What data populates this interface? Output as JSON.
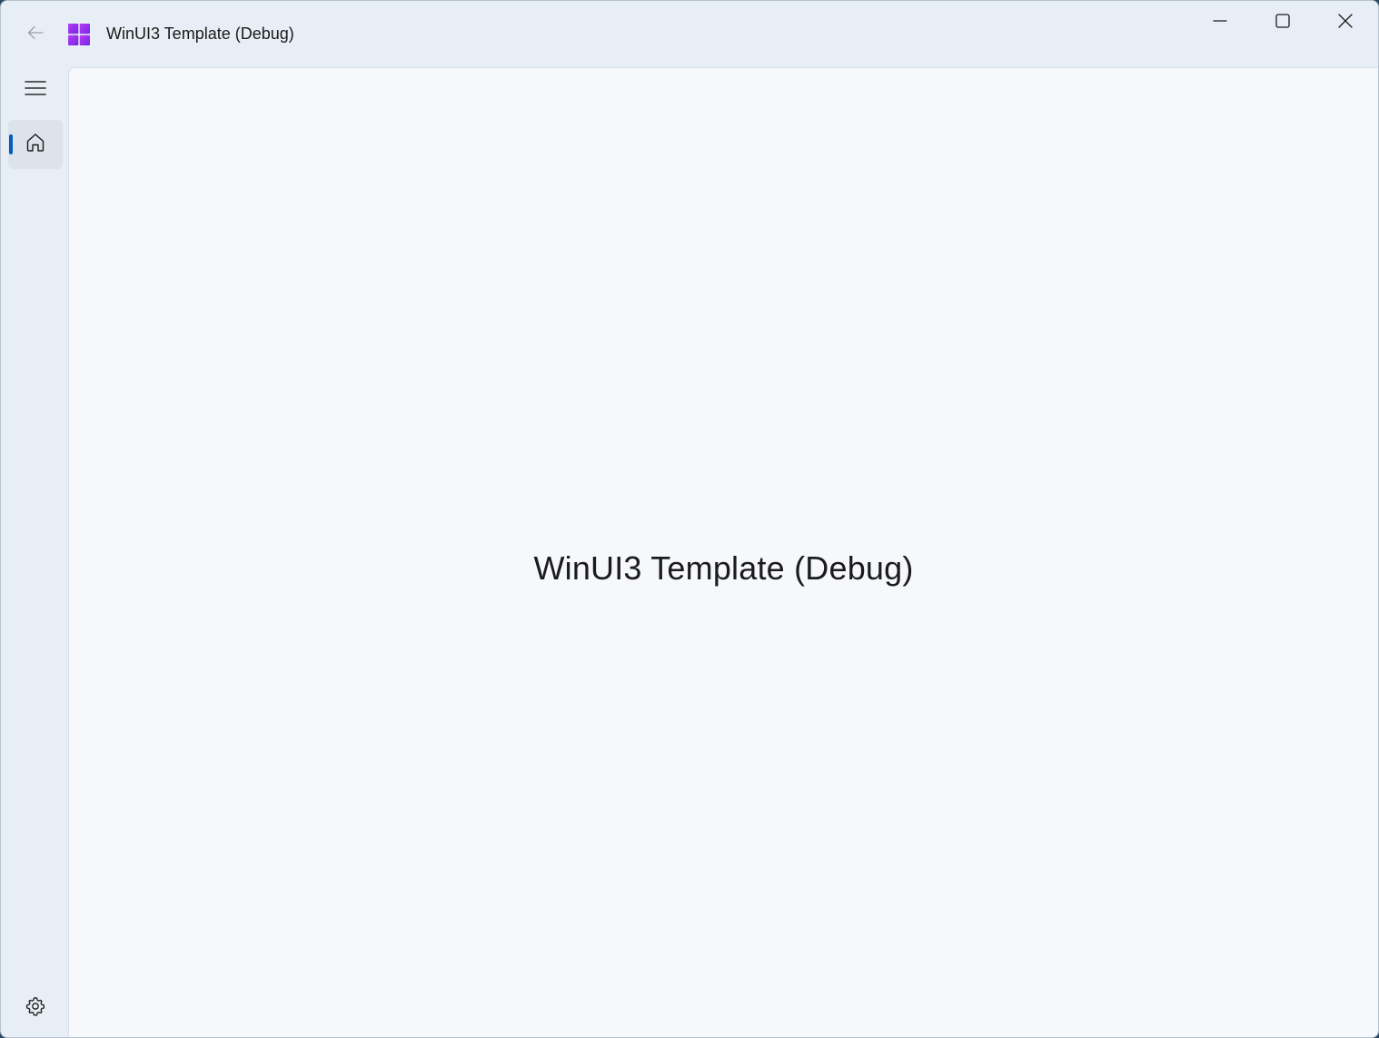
{
  "window": {
    "title": "WinUI3 Template (Debug)"
  },
  "titlebar": {
    "back_icon": "arrow-left-icon",
    "app_icon": "windows-logo-icon",
    "app_icon_colors": [
      "#7b2ff7",
      "#b23cf0",
      "#5a23d6",
      "#8b35f2"
    ],
    "caption_buttons": [
      "minimize",
      "maximize",
      "close"
    ]
  },
  "nav": {
    "menu_icon": "hamburger-icon",
    "items": [
      {
        "id": "home",
        "icon": "home-icon",
        "selected": true
      }
    ],
    "footer_items": [
      {
        "id": "settings",
        "icon": "gear-icon"
      }
    ],
    "accent_color": "#005fb8"
  },
  "main": {
    "heading": "WinUI3 Template (Debug)"
  }
}
